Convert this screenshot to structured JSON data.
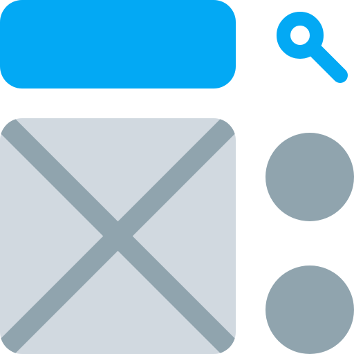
{
  "colors": {
    "accent": "#03A9F4",
    "placeholder_bg": "#D1D9E0",
    "muted": "#90A4AE"
  },
  "icons": {
    "search": "search-icon",
    "image_placeholder": "image-placeholder-icon"
  },
  "list_items": [
    {
      "icon": "circle"
    },
    {
      "icon": "circle"
    }
  ]
}
